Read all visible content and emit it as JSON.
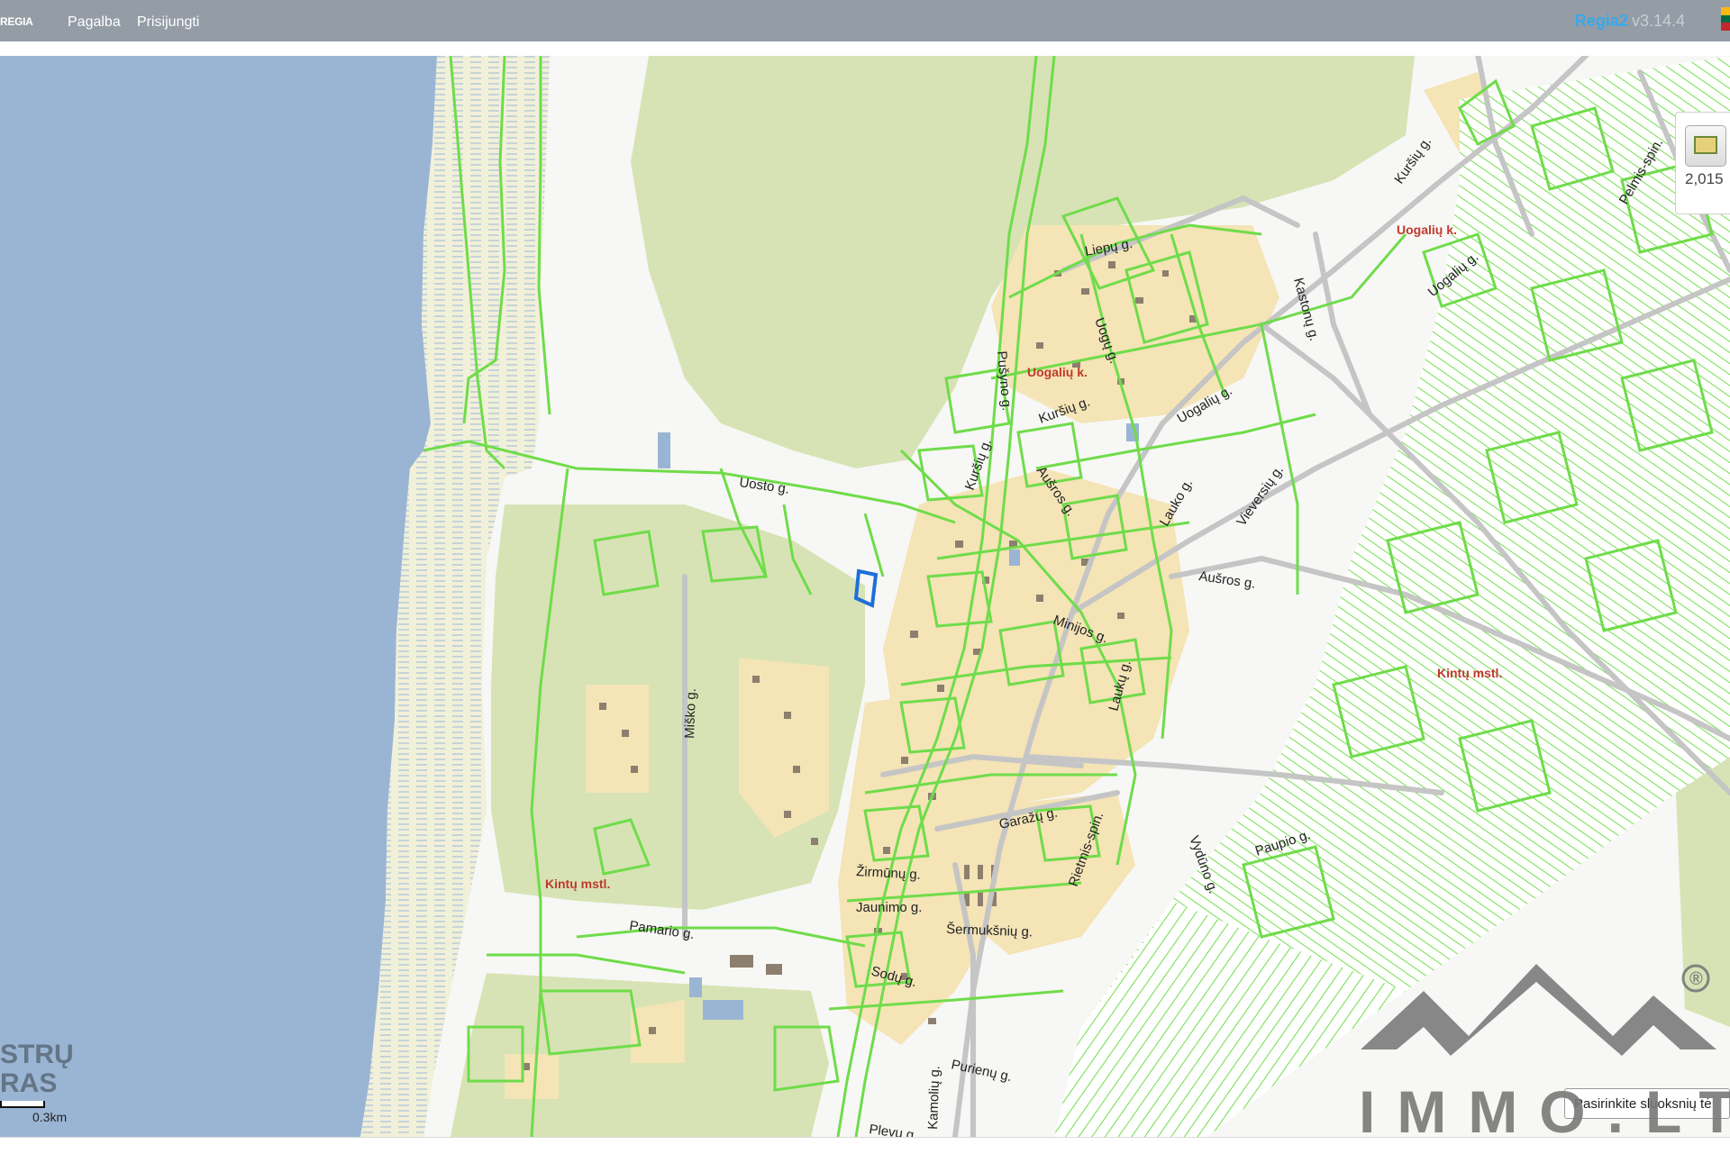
{
  "header": {
    "logo": "REGIA",
    "menu": [
      "Pagalba",
      "Prisijungti"
    ],
    "app_name": "Regia2",
    "version": "v3.14.4"
  },
  "map": {
    "street_labels": [
      "Uosto g.",
      "Liepų g.",
      "Kuršių g.",
      "Kuršių g.",
      "Kuršių g.",
      "Uogų g.",
      "Aušros g.",
      "Aušros g.",
      "Minijos g.",
      "Laukų g.",
      "Miško g.",
      "Garažų g.",
      "Žirmūnų g.",
      "Jaunimo g.",
      "Šermukšnių g.",
      "Sodų g.",
      "Pamario g.",
      "Purienų g.",
      "Kamolių g.",
      "Plevų g.",
      "Vieversių g.",
      "Vydūno g.",
      "Paupio g.",
      "Uogalių g.",
      "Uogalių g.",
      "Pušyno g.",
      "Kastonų g.",
      "Rietmis-spin.",
      "Pelmis-spin.",
      "Lauko g."
    ],
    "place_labels": [
      "Uogalių k.",
      "Uogalių k.",
      "Kintų mstl.",
      "Kintų mstl."
    ],
    "colors": {
      "water": "#9ab5d4",
      "parcel_line": "#6fdc4a",
      "forest": "#d7e3b5",
      "building_area": "#f4e4b6",
      "road": "#c5c5c5"
    }
  },
  "widget": {
    "icon": "basemap-icon",
    "value": "2,015"
  },
  "scale": {
    "label": "0.3km"
  },
  "overlay_text": [
    "STRŲ",
    "RAS"
  ],
  "layer_button": {
    "label": "Pasirinkite sluoksnių tė"
  },
  "watermark": {
    "text": "IMMO.LT",
    "registered": "®"
  }
}
